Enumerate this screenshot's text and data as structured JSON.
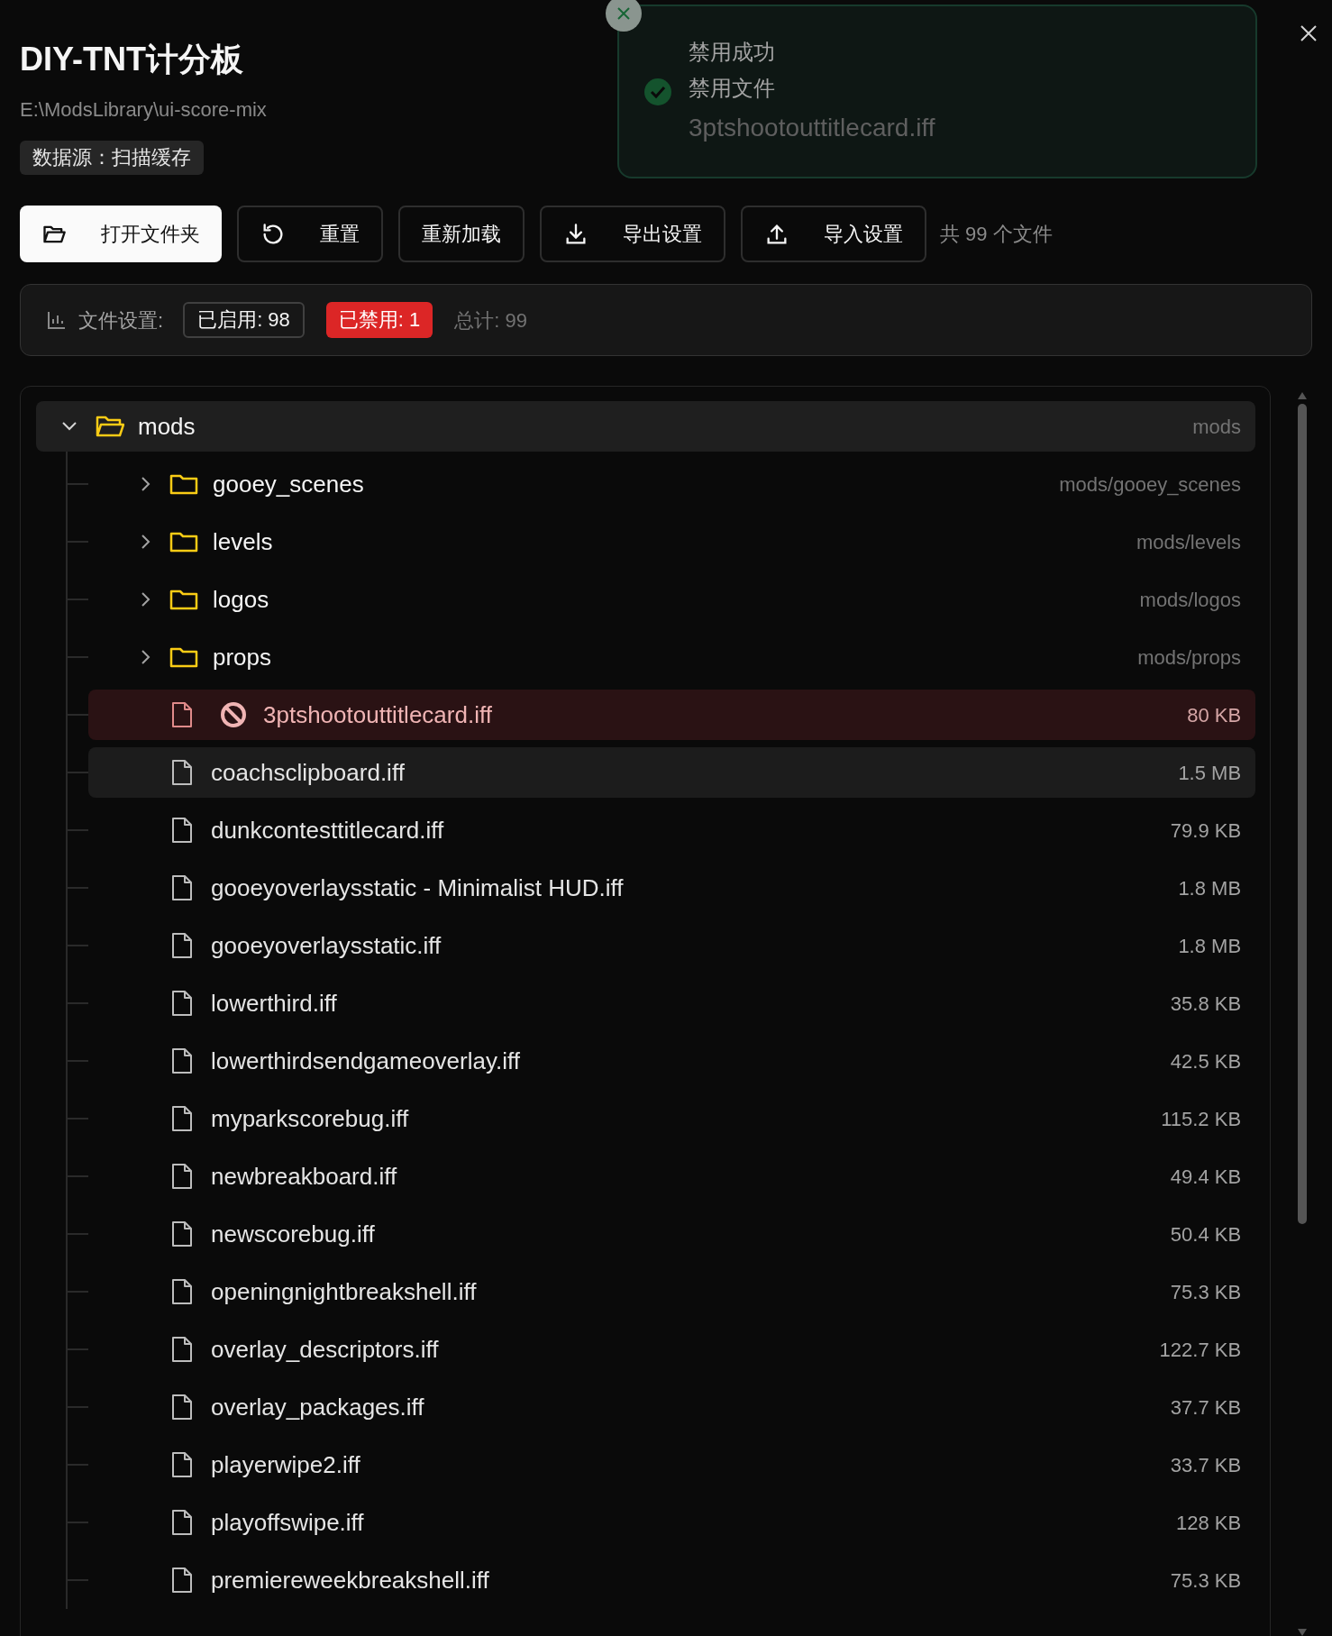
{
  "header": {
    "title": "DIY-TNT计分板",
    "path": "E:\\ModsLibrary\\ui-score-mix",
    "source_badge": "数据源：扫描缓存"
  },
  "toolbar": {
    "buttons": [
      {
        "kind": "open",
        "label": "打开文件夹",
        "primary": true
      },
      {
        "kind": "reset",
        "label": "重置",
        "primary": false
      },
      {
        "kind": "reload",
        "label": "重新加载",
        "primary": false
      },
      {
        "kind": "export",
        "label": "导出设置",
        "primary": false
      },
      {
        "kind": "import",
        "label": "导入设置",
        "primary": false
      }
    ],
    "file_count": "共 99 个文件"
  },
  "stats": {
    "label": "文件设置:",
    "enabled": "已启用: 98",
    "disabled": "已禁用: 1",
    "total": "总计: 99"
  },
  "toast": {
    "title": "禁用成功",
    "message": "禁用文件",
    "detail": "3ptshootouttitlecard.iff"
  },
  "tree": {
    "root": {
      "name": "mods",
      "path": "mods",
      "expanded": true,
      "children": [
        {
          "kind": "folder",
          "name": "gooey_scenes",
          "path": "mods/gooey_scenes",
          "expanded": false
        },
        {
          "kind": "folder",
          "name": "levels",
          "path": "mods/levels",
          "expanded": false
        },
        {
          "kind": "folder",
          "name": "logos",
          "path": "mods/logos",
          "expanded": false
        },
        {
          "kind": "folder",
          "name": "props",
          "path": "mods/props",
          "expanded": false
        },
        {
          "kind": "file",
          "name": "3ptshootouttitlecard.iff",
          "size": "80 KB",
          "disabled": true,
          "selected": false
        },
        {
          "kind": "file",
          "name": "coachsclipboard.iff",
          "size": "1.5 MB",
          "disabled": false,
          "selected": true
        },
        {
          "kind": "file",
          "name": "dunkcontesttitlecard.iff",
          "size": "79.9 KB",
          "disabled": false,
          "selected": false
        },
        {
          "kind": "file",
          "name": "gooeyoverlaysstatic - Minimalist HUD.iff",
          "size": "1.8 MB",
          "disabled": false,
          "selected": false
        },
        {
          "kind": "file",
          "name": "gooeyoverlaysstatic.iff",
          "size": "1.8 MB",
          "disabled": false,
          "selected": false
        },
        {
          "kind": "file",
          "name": "lowerthird.iff",
          "size": "35.8 KB",
          "disabled": false,
          "selected": false
        },
        {
          "kind": "file",
          "name": "lowerthirdsendgameoverlay.iff",
          "size": "42.5 KB",
          "disabled": false,
          "selected": false
        },
        {
          "kind": "file",
          "name": "myparkscorebug.iff",
          "size": "115.2 KB",
          "disabled": false,
          "selected": false
        },
        {
          "kind": "file",
          "name": "newbreakboard.iff",
          "size": "49.4 KB",
          "disabled": false,
          "selected": false
        },
        {
          "kind": "file",
          "name": "newscorebug.iff",
          "size": "50.4 KB",
          "disabled": false,
          "selected": false
        },
        {
          "kind": "file",
          "name": "openingnightbreakshell.iff",
          "size": "75.3 KB",
          "disabled": false,
          "selected": false
        },
        {
          "kind": "file",
          "name": "overlay_descriptors.iff",
          "size": "122.7 KB",
          "disabled": false,
          "selected": false
        },
        {
          "kind": "file",
          "name": "overlay_packages.iff",
          "size": "37.7 KB",
          "disabled": false,
          "selected": false
        },
        {
          "kind": "file",
          "name": "playerwipe2.iff",
          "size": "33.7 KB",
          "disabled": false,
          "selected": false
        },
        {
          "kind": "file",
          "name": "playoffswipe.iff",
          "size": "128 KB",
          "disabled": false,
          "selected": false
        },
        {
          "kind": "file",
          "name": "premiereweekbreakshell.iff",
          "size": "75.3 KB",
          "disabled": false,
          "selected": false
        }
      ]
    }
  }
}
